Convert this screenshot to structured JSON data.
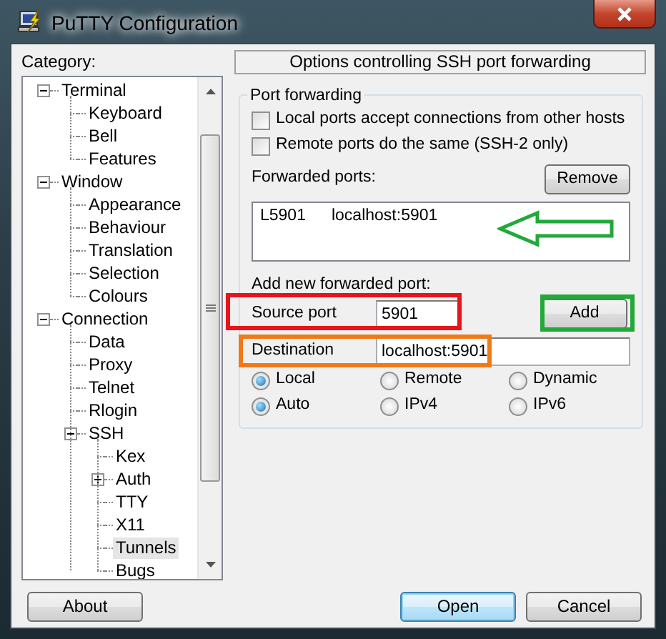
{
  "window": {
    "title": "PuTTY Configuration"
  },
  "category": {
    "label": "Category:",
    "tree": [
      {
        "label": "Terminal",
        "expanded": true,
        "selected": false,
        "children": [
          {
            "label": "Keyboard",
            "selected": false
          },
          {
            "label": "Bell",
            "selected": false
          },
          {
            "label": "Features",
            "selected": false
          }
        ]
      },
      {
        "label": "Window",
        "expanded": true,
        "selected": false,
        "children": [
          {
            "label": "Appearance",
            "selected": false
          },
          {
            "label": "Behaviour",
            "selected": false
          },
          {
            "label": "Translation",
            "selected": false
          },
          {
            "label": "Selection",
            "selected": false
          },
          {
            "label": "Colours",
            "selected": false
          }
        ]
      },
      {
        "label": "Connection",
        "expanded": true,
        "selected": false,
        "children": [
          {
            "label": "Data",
            "selected": false
          },
          {
            "label": "Proxy",
            "selected": false
          },
          {
            "label": "Telnet",
            "selected": false
          },
          {
            "label": "Rlogin",
            "selected": false
          },
          {
            "label": "SSH",
            "expanded": true,
            "selected": false,
            "children": [
              {
                "label": "Kex",
                "selected": false
              },
              {
                "label": "Auth",
                "expanded": false,
                "selected": false
              },
              {
                "label": "TTY",
                "selected": false
              },
              {
                "label": "X11",
                "selected": false
              },
              {
                "label": "Tunnels",
                "selected": true
              },
              {
                "label": "Bugs",
                "selected": false
              }
            ]
          }
        ]
      }
    ]
  },
  "panel": {
    "header": "Options controlling SSH port forwarding",
    "group_title": "Port forwarding",
    "options": [
      {
        "label": "Local ports accept connections from other hosts",
        "checked": false
      },
      {
        "label": "Remote ports do the same (SSH-2 only)",
        "checked": false
      }
    ],
    "forwarded_ports": {
      "label": "Forwarded ports:",
      "remove_button": "Remove",
      "entries": [
        {
          "source": "L5901",
          "destination": "localhost:5901"
        }
      ]
    },
    "add_new": {
      "label": "Add new forwarded port:",
      "source_port": {
        "label": "Source port",
        "value": "5901"
      },
      "add_button": "Add",
      "destination": {
        "label": "Destination",
        "value": "localhost:5901"
      },
      "direction": [
        {
          "label": "Local",
          "selected": true
        },
        {
          "label": "Remote",
          "selected": false
        },
        {
          "label": "Dynamic",
          "selected": false
        }
      ],
      "protocol": [
        {
          "label": "Auto",
          "selected": true
        },
        {
          "label": "IPv4",
          "selected": false
        },
        {
          "label": "IPv6",
          "selected": false
        }
      ]
    }
  },
  "buttons": [
    {
      "label": "About",
      "default": false
    },
    {
      "label": "Open",
      "default": true
    },
    {
      "label": "Cancel",
      "default": false
    }
  ]
}
